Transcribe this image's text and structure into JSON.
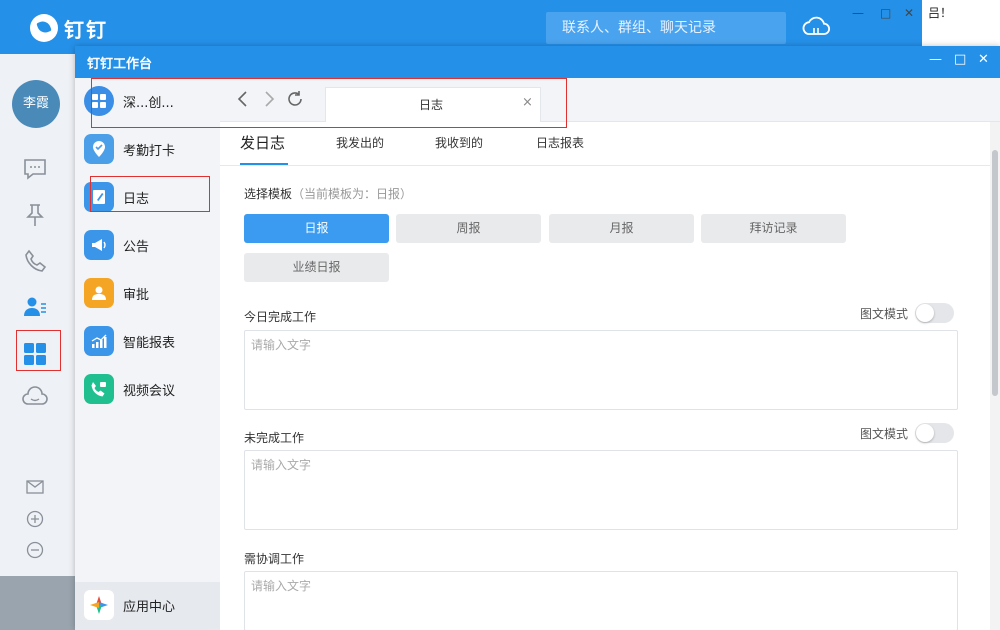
{
  "desktop": {
    "fragment_text": "吕！"
  },
  "main_window": {
    "app_name": "钉钉",
    "search_placeholder": "联系人、群组、聊天记录",
    "user_avatar_text": "李霞",
    "rail_icons": [
      "chat-icon",
      "pin-icon",
      "phone-icon",
      "contacts-icon",
      "workbench-grid-icon",
      "cloud-drive-icon",
      "mail-icon",
      "add-circle-icon",
      "more-circle-icon"
    ]
  },
  "workbench": {
    "title": "钉钉工作台",
    "apps": [
      {
        "label": "深...创...",
        "icon": "grid-app-icon",
        "color": "#3a8ee6"
      },
      {
        "label": "考勤打卡",
        "icon": "location-check-icon",
        "color": "#4a9fe8"
      },
      {
        "label": "日志",
        "icon": "journal-icon",
        "color": "#3b96ea"
      },
      {
        "label": "公告",
        "icon": "megaphone-icon",
        "color": "#3b96ea"
      },
      {
        "label": "审批",
        "icon": "person-badge-icon",
        "color": "#f5a524"
      },
      {
        "label": "智能报表",
        "icon": "chart-up-icon",
        "color": "#3b96ea"
      },
      {
        "label": "视频会议",
        "icon": "video-phone-icon",
        "color": "#1fbf8f"
      }
    ],
    "app_center_label": "应用中心",
    "tab_label": "日志",
    "tab_close": "×",
    "sub_tabs": [
      "发日志",
      "我发出的",
      "我收到的",
      "日志报表"
    ],
    "template_label": "选择模板",
    "template_hint": "（当前模板为：日报）",
    "templates": [
      {
        "label": "日报",
        "active": true
      },
      {
        "label": "周报",
        "active": false
      },
      {
        "label": "月报",
        "active": false
      },
      {
        "label": "拜访记录",
        "active": false
      },
      {
        "label": "业绩日报",
        "active": false
      }
    ],
    "sections": [
      {
        "title": "今日完成工作",
        "mode_label": "图文模式",
        "placeholder": "请输入文字"
      },
      {
        "title": "未完成工作",
        "mode_label": "图文模式",
        "placeholder": "请输入文字"
      },
      {
        "title": "需协调工作",
        "placeholder": "请输入文字"
      }
    ]
  },
  "colors": {
    "brand": "#2590e8",
    "active_template": "#3a9bf0",
    "annotation": "#e03030"
  }
}
